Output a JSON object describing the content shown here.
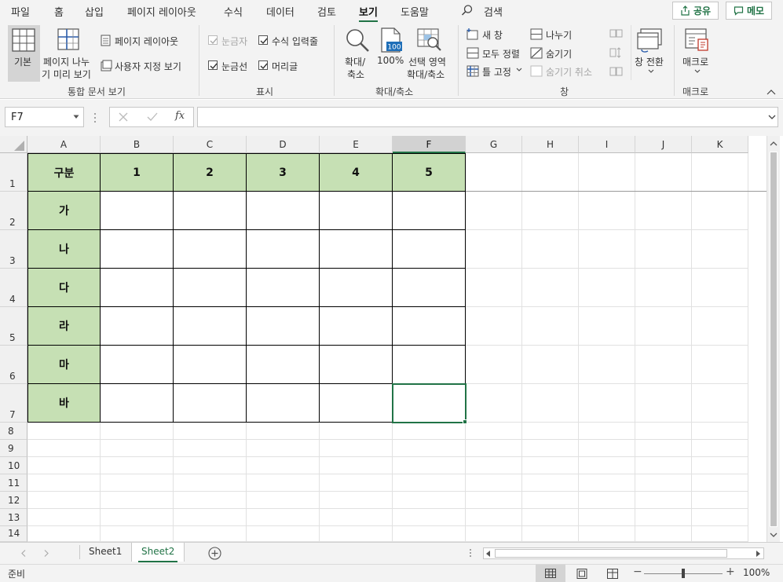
{
  "ribbon_tabs": [
    "파일",
    "홈",
    "삽입",
    "페이지 레이아웃",
    "수식",
    "데이터",
    "검토",
    "보기",
    "도움말"
  ],
  "active_tab": "보기",
  "search": {
    "label": "검색"
  },
  "share_button": "공유",
  "memo_button": "메모",
  "workbook_views": {
    "normal": "기본",
    "page_break_line1": "페이지 나누",
    "page_break_line2": "기 미리 보기",
    "page_layout": "페이지 레이아웃",
    "custom_views": "사용자 지정 보기",
    "group_label": "통합 문서 보기"
  },
  "show": {
    "ruler": "눈금자",
    "formula_bar": "수식 입력줄",
    "gridlines": "눈금선",
    "headings": "머리글",
    "group_label": "표시"
  },
  "zoom": {
    "zoom_line1": "확대/",
    "zoom_line2": "축소",
    "hundred": "100%",
    "zoom_sel_line1": "선택 영역",
    "zoom_sel_line2": "확대/축소",
    "group_label": "확대/축소"
  },
  "window": {
    "new_window": "새 창",
    "arrange_all": "모두 정렬",
    "freeze_panes": "틀 고정",
    "split": "나누기",
    "hide": "숨기기",
    "unhide": "숨기기 취소",
    "switch_windows": "창 전환",
    "group_label": "창"
  },
  "macros": {
    "label": "매크로",
    "group_label": "매크로"
  },
  "name_box": "F7",
  "fx": "fx",
  "columns": [
    "A",
    "B",
    "C",
    "D",
    "E",
    "F",
    "G",
    "H",
    "I",
    "J",
    "K"
  ],
  "selected_column": "F",
  "rows": [
    "1",
    "2",
    "3",
    "4",
    "5",
    "6",
    "7",
    "8",
    "9",
    "10",
    "11",
    "12",
    "13",
    "14"
  ],
  "table": {
    "header": [
      "구분",
      "1",
      "2",
      "3",
      "4",
      "5"
    ],
    "row_labels": [
      "가",
      "나",
      "다",
      "라",
      "마",
      "바"
    ]
  },
  "sheets": [
    "Sheet1",
    "Sheet2"
  ],
  "active_sheet": "Sheet2",
  "status": {
    "ready": "준비",
    "zoom_level": "100%"
  },
  "colors": {
    "accent": "#217346",
    "table_header_fill": "#c6e0b4"
  }
}
